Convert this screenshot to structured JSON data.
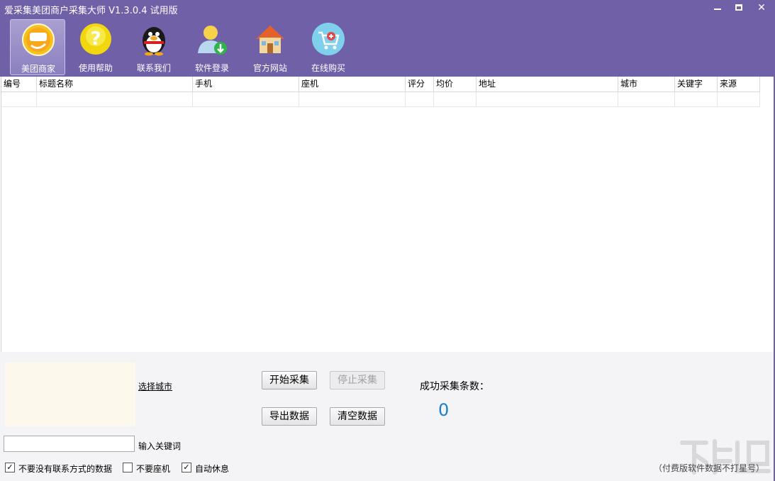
{
  "window": {
    "title": "爱采集美团商户采集大师 V1.3.0.4 试用版"
  },
  "toolbar": {
    "items": [
      {
        "label": "美团商家",
        "icon": "meituan-icon",
        "active": true
      },
      {
        "label": "使用帮助",
        "icon": "help-icon"
      },
      {
        "label": "联系我们",
        "icon": "qq-penguin-icon"
      },
      {
        "label": "软件登录",
        "icon": "user-login-icon"
      },
      {
        "label": "官方网站",
        "icon": "house-icon"
      },
      {
        "label": "在线购买",
        "icon": "cart-icon"
      }
    ]
  },
  "table": {
    "columns": [
      "编号",
      "标题名称",
      "手机",
      "座机",
      "评分",
      "均价",
      "地址",
      "城市",
      "关键字",
      "来源"
    ]
  },
  "panel": {
    "select_city": "选择城市",
    "start_button": "开始采集",
    "stop_button": "停止采集",
    "export_button": "导出数据",
    "clear_button": "清空数据",
    "count_label": "成功采集条数：",
    "count_value": "0",
    "keyword_label": "输入关键词",
    "keyword_value": "",
    "check_no_contact": "不要没有联系方式的数据",
    "check_no_landline": "不要座机",
    "check_auto_rest": "自动休息",
    "note": "（付费版软件数据不打星号）"
  },
  "colors": {
    "titlebar": "#7060a8",
    "count": "#1a7fc8"
  }
}
